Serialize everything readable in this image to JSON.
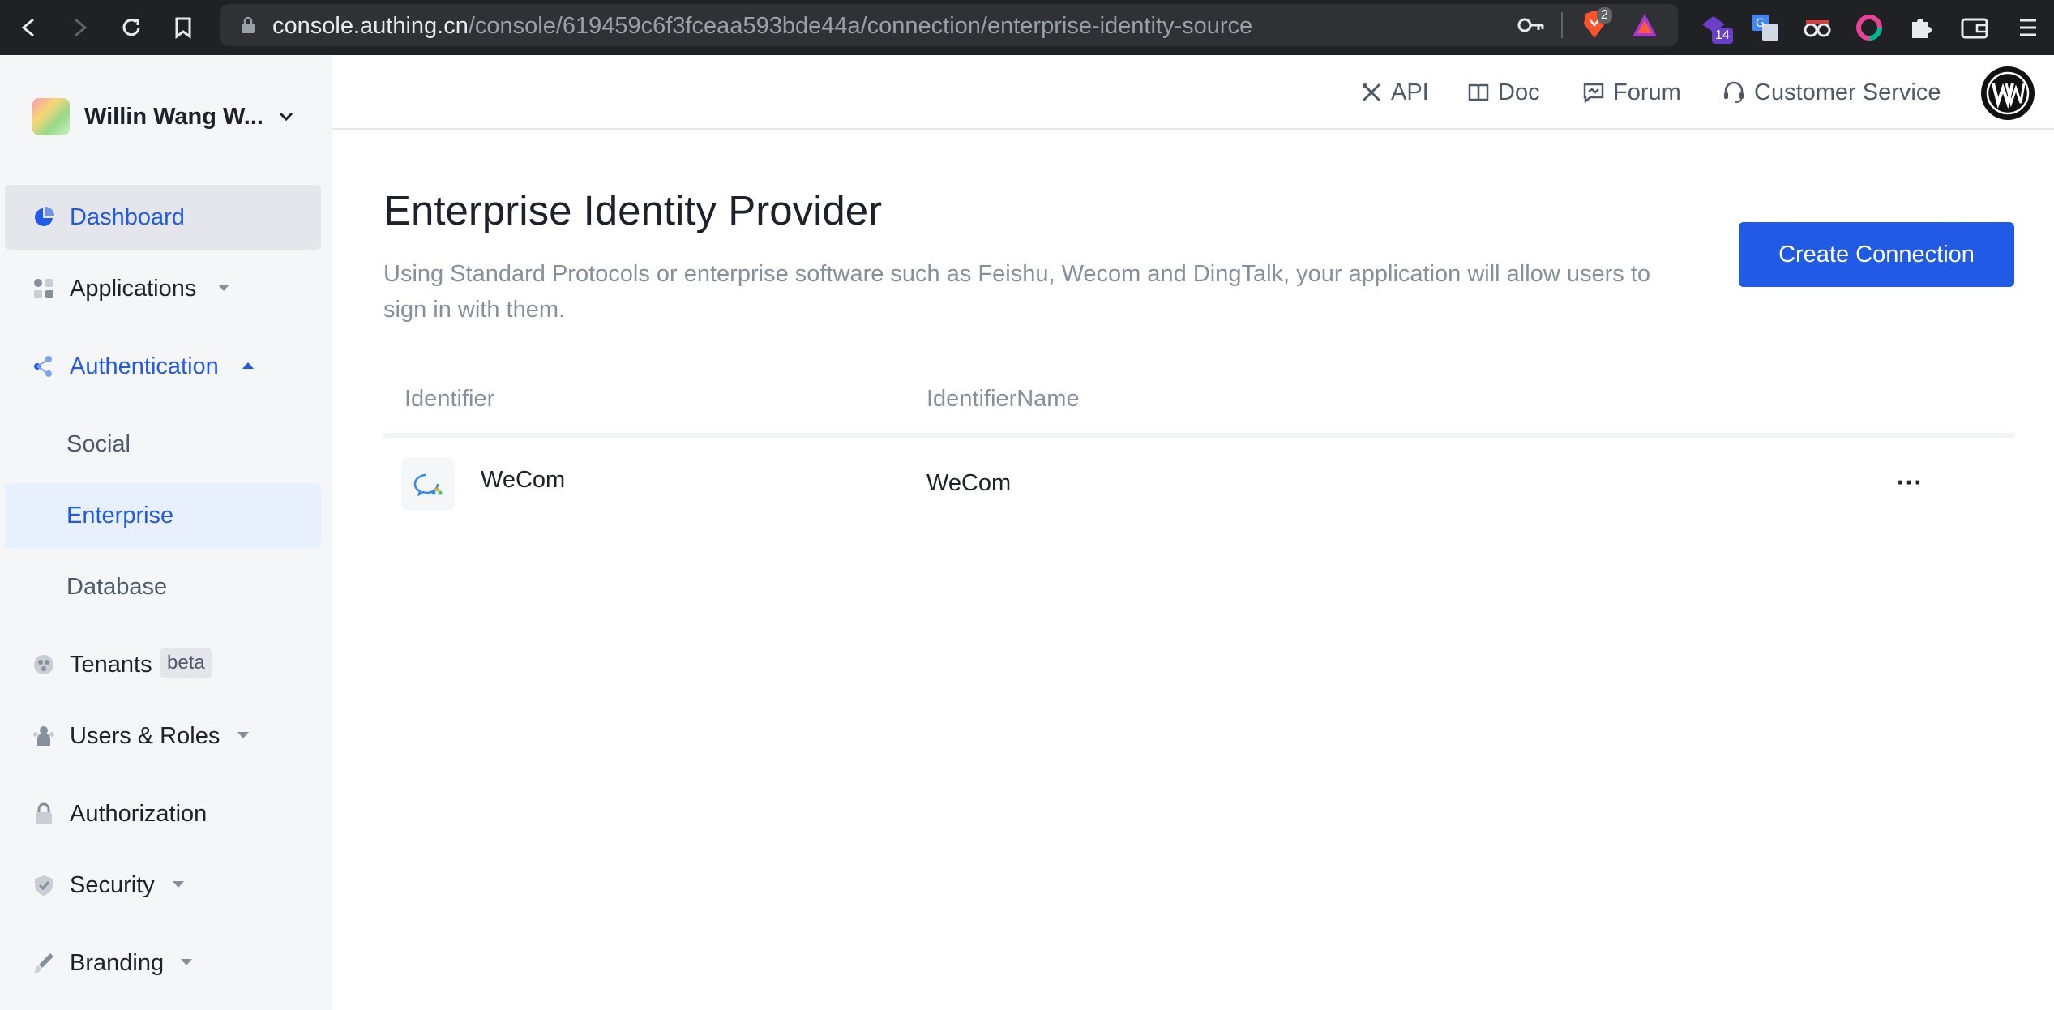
{
  "browser": {
    "url_host": "console.authing.cn",
    "url_path": "/console/619459c6f3fceaa593bde44a/connection/enterprise-identity-source",
    "brave_badge": "2",
    "ext_badge": "14"
  },
  "sidebar": {
    "org_name": "Willin Wang W...",
    "items": [
      {
        "label": "Dashboard"
      },
      {
        "label": "Applications"
      },
      {
        "label": "Authentication"
      },
      {
        "label": "Social"
      },
      {
        "label": "Enterprise"
      },
      {
        "label": "Database"
      },
      {
        "label": "Tenants",
        "badge": "beta"
      },
      {
        "label": "Users & Roles"
      },
      {
        "label": "Authorization"
      },
      {
        "label": "Security"
      },
      {
        "label": "Branding"
      }
    ]
  },
  "header": {
    "links": [
      {
        "label": "API"
      },
      {
        "label": "Doc"
      },
      {
        "label": "Forum"
      },
      {
        "label": "Customer Service"
      }
    ],
    "avatar_text": "W.W"
  },
  "main": {
    "title": "Enterprise Identity Provider",
    "description": "Using Standard Protocols or enterprise software such as Feishu, Wecom and DingTalk, your application will allow users to sign in with them.",
    "create_button": "Create Connection",
    "table": {
      "columns": [
        "Identifier",
        "IdentifierName"
      ],
      "rows": [
        {
          "identifier": "WeCom",
          "name": "WeCom",
          "more": "···"
        }
      ]
    }
  },
  "colors": {
    "primary": "#215ae5",
    "sidebar_bg": "#f5f6f8",
    "browser_bg": "#202124"
  }
}
